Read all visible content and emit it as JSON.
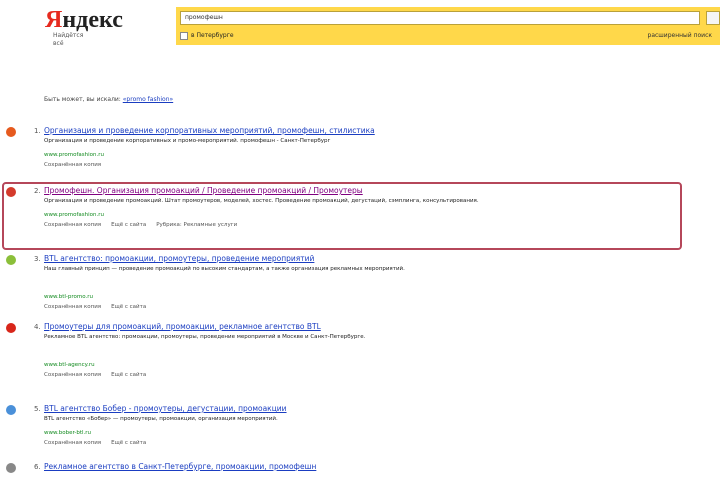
{
  "logo": {
    "first_letter": "Я",
    "rest": "ндекс",
    "subtitle": "Найдётся\nвсё"
  },
  "search": {
    "query": "промофешн"
  },
  "region_label": "в Петербурге",
  "advanced_label": "расширенный поиск",
  "hint": {
    "text": "Быть может, вы искали: ",
    "suggestion": "«promo fashion»"
  },
  "results": [
    {
      "number": "1.",
      "title": "Организация и проведение корпоративных мероприятий, промофешн, стилистика",
      "snippet": "Организация и проведение корпоративных и промо-мероприятий. промофешн - Санкт-Петербург",
      "url": "www.promofashion.ru",
      "meta": "",
      "links": [
        "Сохранённая копия"
      ],
      "visited": false,
      "icon_color": "#e65a1e"
    },
    {
      "number": "2.",
      "title": "Промофешн. Организация промоакций / Проведение промоакций / Промоутеры",
      "snippet": "Организация и проведение промоакций. Штат промоутеров, моделей, хостес. Проведение промоакций, дегустаций, сэмплинга, консультирования.",
      "url": "www.promofashion.ru",
      "meta": "",
      "links": [
        "Сохранённая копия",
        "Ещё с сайта",
        "Рубрика: Рекламные услуги"
      ],
      "visited": true,
      "icon_color": "#d43b2c"
    },
    {
      "number": "3.",
      "title": "BTL агентство: промоакции, промоутеры, проведение мероприятий",
      "snippet": "Наш главный принцип — проведение промоакций по высоким стандартам, а также организация рекламных мероприятий.",
      "url": "www.btl-promo.ru",
      "meta": "",
      "links": [
        "Сохранённая копия",
        "Ещё с сайта"
      ],
      "visited": false,
      "icon_color": "#8bbf3a"
    },
    {
      "number": "4.",
      "title": "Промоутеры для промоакций, промоакции, рекламное агентство BTL",
      "snippet": "Рекламное BTL агентство: промоакции, промоутеры, проведение мероприятий в Москве и Санкт-Петербурге.",
      "url": "www.btl-agency.ru",
      "meta": "",
      "links": [
        "Сохранённая копия",
        "Ещё с сайта"
      ],
      "visited": false,
      "icon_color": "#d8261a"
    },
    {
      "number": "5.",
      "title": "BTL агентство Бобер - промоутеры, дегустации, промоакции",
      "snippet": "BTL агентство «Бобер» — промоутеры, промоакции, организация мероприятий.",
      "url": "www.bober-btl.ru",
      "meta": "",
      "links": [
        "Сохранённая копия",
        "Ещё с сайта"
      ],
      "visited": false,
      "icon_color": "#4a90d9"
    },
    {
      "number": "6.",
      "title": "Рекламное агентство в Санкт-Петербурге, промоакции, промофешн",
      "snippet": "",
      "url": "",
      "meta": "",
      "links": [],
      "visited": false,
      "icon_color": "#888888"
    }
  ]
}
